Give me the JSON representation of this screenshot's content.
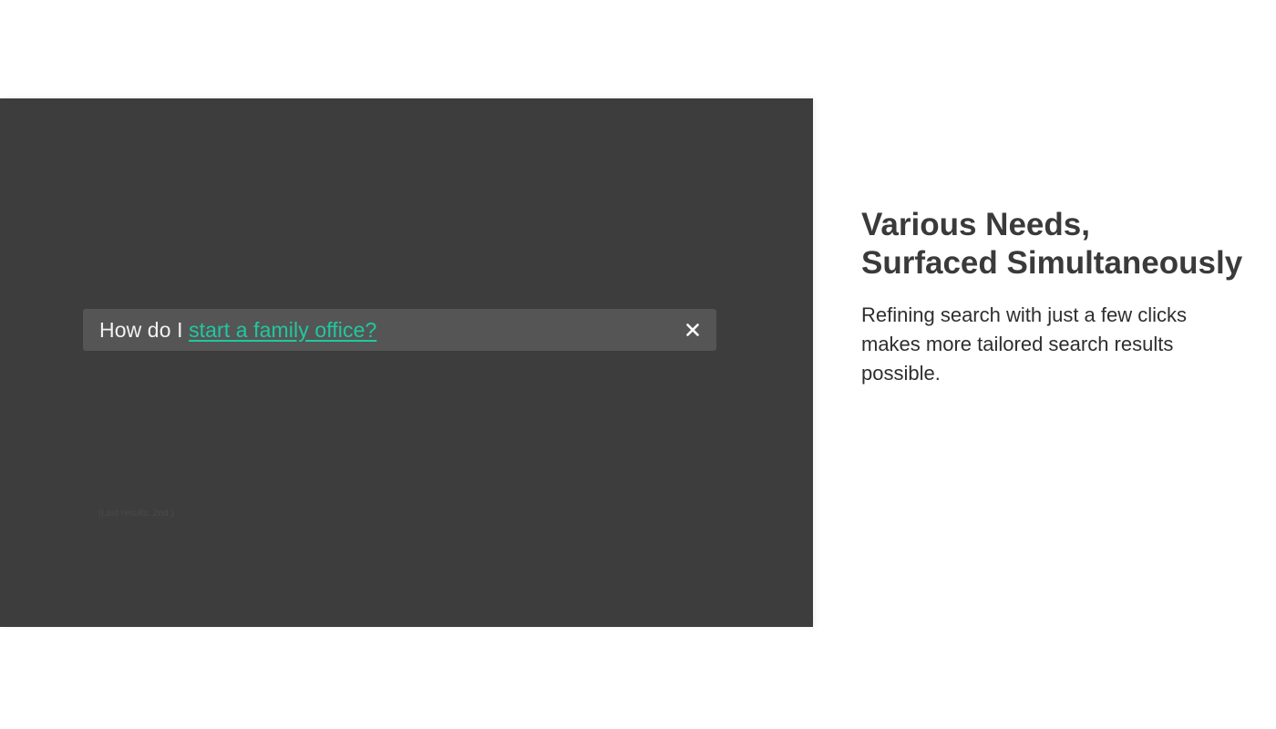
{
  "search": {
    "query_prefix": "How do I ",
    "query_link": "start a family office?",
    "clear_icon": "close-icon",
    "hint": "(Last results: 2nd.)"
  },
  "feature": {
    "title_line1": "Various Needs,",
    "title_line2": "Surfaced Simultaneously",
    "description": "Refining search with just a few clicks makes more tailored search results possible."
  },
  "colors": {
    "panel_background": "#3d3d3d",
    "search_bar_background": "#555555",
    "accent_link": "#1fc8a0",
    "title_text": "#3a3a3a"
  }
}
